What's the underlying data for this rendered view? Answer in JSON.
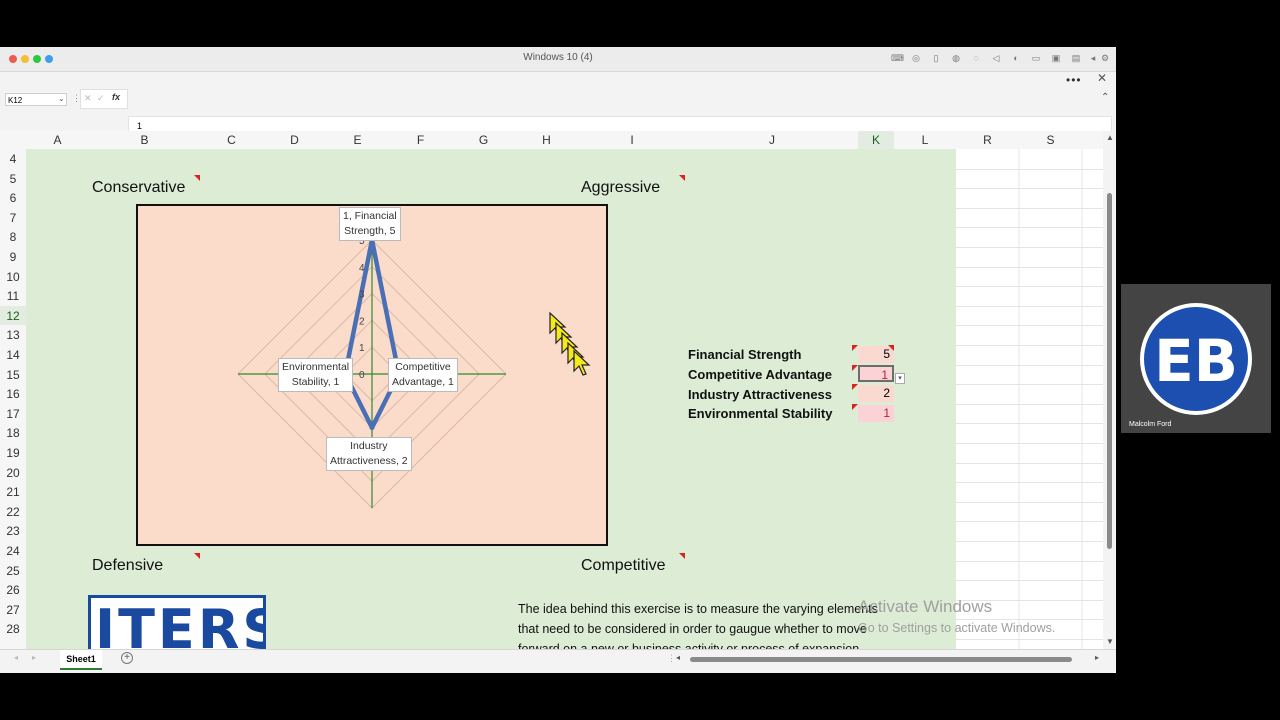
{
  "window": {
    "title": "Windows 10 (4)"
  },
  "formula_bar": {
    "name_box": "K12",
    "fx_symbol": "fx",
    "value": "1"
  },
  "columns": [
    "A",
    "B",
    "C",
    "D",
    "E",
    "F",
    "G",
    "H",
    "I",
    "J",
    "K",
    "L",
    "R",
    "S"
  ],
  "rows": [
    "4",
    "5",
    "6",
    "7",
    "8",
    "9",
    "10",
    "11",
    "12",
    "13",
    "14",
    "15",
    "16",
    "17",
    "18",
    "19",
    "20",
    "21",
    "22",
    "23",
    "24",
    "25",
    "26",
    "27",
    "28"
  ],
  "sheet": {
    "quadrant_labels": {
      "top_left": "Conservative",
      "top_right": "Aggressive",
      "bottom_left": "Defensive",
      "bottom_right": "Competitive"
    },
    "metrics": [
      {
        "label": "Financial Strength",
        "value": "5"
      },
      {
        "label": "Competitive Advantage",
        "value": "1"
      },
      {
        "label": "Industry Attractiveness",
        "value": "2"
      },
      {
        "label": "Environmental Stability",
        "value": "1"
      }
    ],
    "description": "The idea behind this exercise is to measure the varying elements that need to be considered in order to gaugue whether to move forward on a new or business activity or process of expansion",
    "logo_text": "ITERS"
  },
  "chart_data": {
    "type": "radar",
    "categories": [
      "Financial Strength",
      "Competitive Advantage",
      "Industry Attractiveness",
      "Environmental Stability"
    ],
    "values": [
      5,
      1,
      2,
      1
    ],
    "radial_ticks": [
      "0",
      "1",
      "2",
      "3",
      "4",
      "5"
    ],
    "range": [
      0,
      5
    ],
    "data_labels": [
      {
        "line1": "1, Financial",
        "line2": "Strength, 5"
      },
      {
        "line1": "Competitive",
        "line2": "Advantage, 1"
      },
      {
        "line1": "Industry",
        "line2": "Attractiveness, 2"
      },
      {
        "line1": "Environmental",
        "line2": "Stability, 1"
      }
    ],
    "colors": {
      "series": "#4a6fb5",
      "axes": "#2e8b2e",
      "background": "#fbdccb"
    }
  },
  "tabs": {
    "sheet1": "Sheet1"
  },
  "watermark": {
    "line1": "Activate Windows",
    "line2": "Go to Settings to activate Windows."
  },
  "video": {
    "participant": "Malcolm Ford",
    "avatar_text": "EB"
  }
}
